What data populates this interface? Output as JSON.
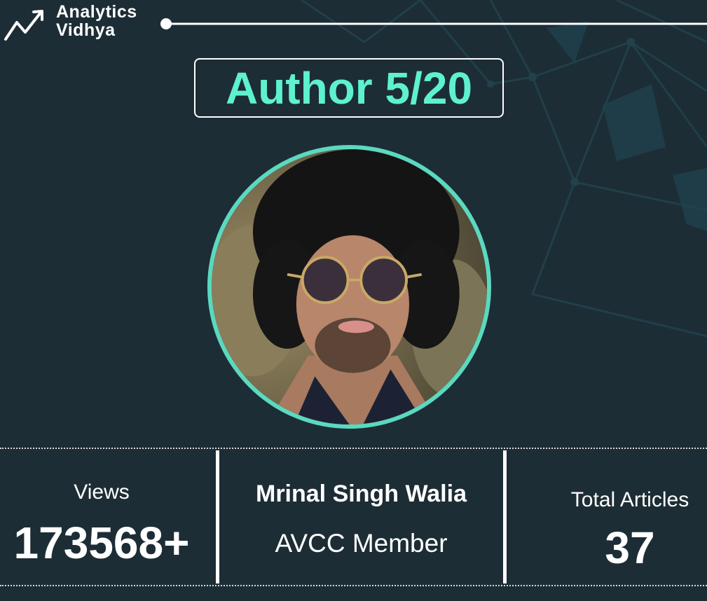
{
  "brand": {
    "name_line1": "Analytics",
    "name_line2": "Vidhya",
    "logo_icon": "trend-arrow-icon"
  },
  "header": {
    "title": "Author 5/20"
  },
  "author": {
    "name": "Mrinal Singh Walia",
    "role": "AVCC Member"
  },
  "stats": {
    "views_label": "Views",
    "views_value": "173568+",
    "articles_label": "Total Articles",
    "articles_value": "37"
  },
  "colors": {
    "background": "#1d2d35",
    "accent": "#5ef1cf",
    "avatar_border": "#5ad9c0",
    "text": "#ffffff"
  }
}
